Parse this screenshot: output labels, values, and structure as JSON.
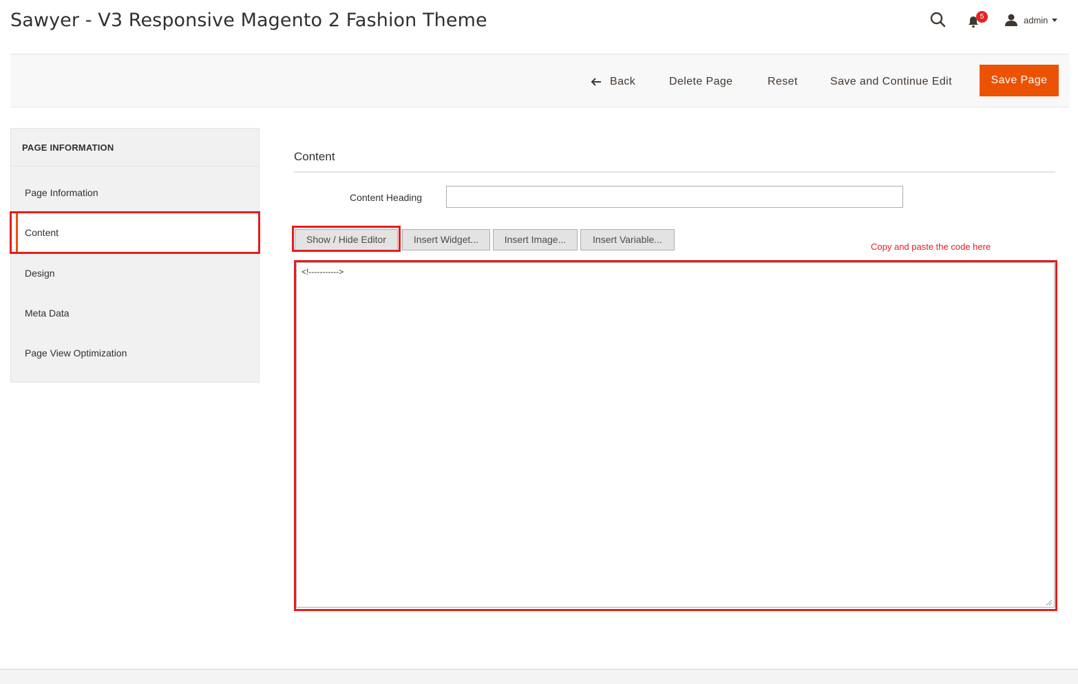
{
  "header": {
    "title": "Sawyer - V3 Responsive Magento 2 Fashion Theme",
    "notifications_count": "5",
    "user_name": "admin"
  },
  "actions": {
    "back": "Back",
    "delete": "Delete Page",
    "reset": "Reset",
    "save_continue": "Save and Continue Edit",
    "save_page": "Save Page"
  },
  "sidebar": {
    "title": "PAGE INFORMATION",
    "items": [
      {
        "label": "Page Information"
      },
      {
        "label": "Content",
        "active": true
      },
      {
        "label": "Design"
      },
      {
        "label": "Meta Data"
      },
      {
        "label": "Page View Optimization"
      }
    ]
  },
  "content": {
    "section_title": "Content",
    "heading_label": "Content Heading",
    "heading_value": "",
    "buttons": {
      "show_hide": "Show / Hide Editor",
      "insert_widget": "Insert Widget...",
      "insert_image": "Insert Image...",
      "insert_variable": "Insert Variable..."
    },
    "annotation": "Copy and paste the code here",
    "editor_value": "<!----------->"
  },
  "colors": {
    "accent": "#eb5202",
    "highlight": "#e61c1c",
    "badge": "#e22626"
  }
}
